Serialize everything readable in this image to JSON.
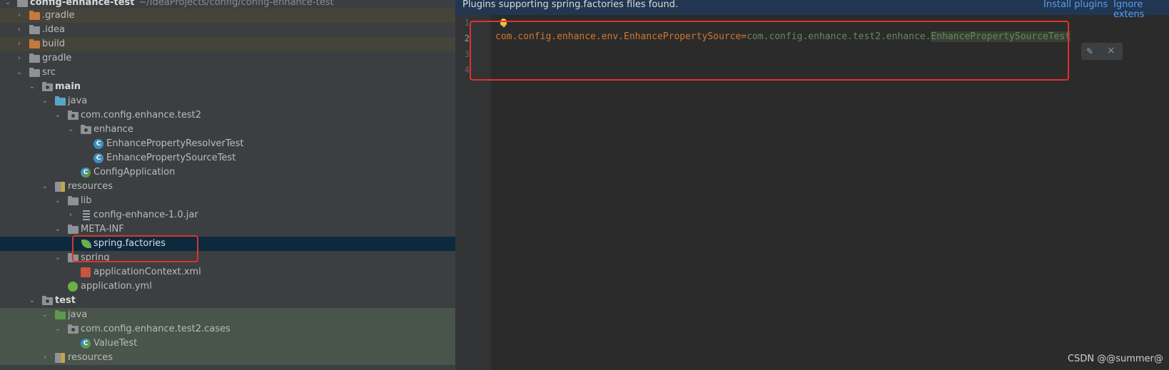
{
  "project": {
    "root_name": "config-enhance-test",
    "root_path": "~/IdeaProjects/config/config-enhance-test"
  },
  "tree": [
    {
      "label": ".gradle",
      "icon": "folder-orange-icon"
    },
    {
      "label": ".idea",
      "icon": "folder-gray-icon"
    },
    {
      "label": "build",
      "icon": "folder-orange-icon"
    },
    {
      "label": "gradle",
      "icon": "folder-gray-icon"
    },
    {
      "label": "src",
      "icon": "folder-gray-icon"
    },
    {
      "label": "main",
      "icon": "source-folder-icon"
    },
    {
      "label": "java",
      "icon": "folder-blue-icon"
    },
    {
      "label": "com.config.enhance.test2",
      "icon": "package-icon"
    },
    {
      "label": "enhance",
      "icon": "package-icon"
    },
    {
      "label": "EnhancePropertyResolverTest",
      "icon": "class-icon"
    },
    {
      "label": "EnhancePropertySourceTest",
      "icon": "class-icon"
    },
    {
      "label": "ConfigApplication",
      "icon": "spring-boot-class-icon"
    },
    {
      "label": "resources",
      "icon": "resources-folder-icon"
    },
    {
      "label": "lib",
      "icon": "folder-gray-icon"
    },
    {
      "label": "config-enhance-1.0.jar",
      "icon": "jar-icon"
    },
    {
      "label": "META-INF",
      "icon": "folder-gray-icon"
    },
    {
      "label": "spring.factories",
      "icon": "spring-leaf-icon"
    },
    {
      "label": "spring",
      "icon": "folder-gray-icon"
    },
    {
      "label": "applicationContext.xml",
      "icon": "xml-file-icon"
    },
    {
      "label": "application.yml",
      "icon": "yml-file-icon"
    },
    {
      "label": "test",
      "icon": "test-folder-icon"
    },
    {
      "label": "java",
      "icon": "folder-green-icon"
    },
    {
      "label": "com.config.enhance.test2.cases",
      "icon": "package-icon"
    },
    {
      "label": "ValueTest",
      "icon": "spring-boot-class-icon"
    },
    {
      "label": "resources",
      "icon": "resources-folder-icon"
    }
  ],
  "editor": {
    "banner_text": "Plugins supporting spring.factories files found.",
    "install_plugins": "Install plugins",
    "ignore_extensions": "Ignore extens",
    "line_numbers": [
      "1",
      "2",
      "3",
      "4"
    ],
    "code_key": "com.config.enhance.env.EnhancePropertySource",
    "code_eq": "=",
    "code_value_pkg": "com.config.enhance.test2.enhance.",
    "code_value_class": "EnhancePropertySourceTest",
    "close_glyph": "×"
  },
  "watermark": "CSDN @@summer@"
}
